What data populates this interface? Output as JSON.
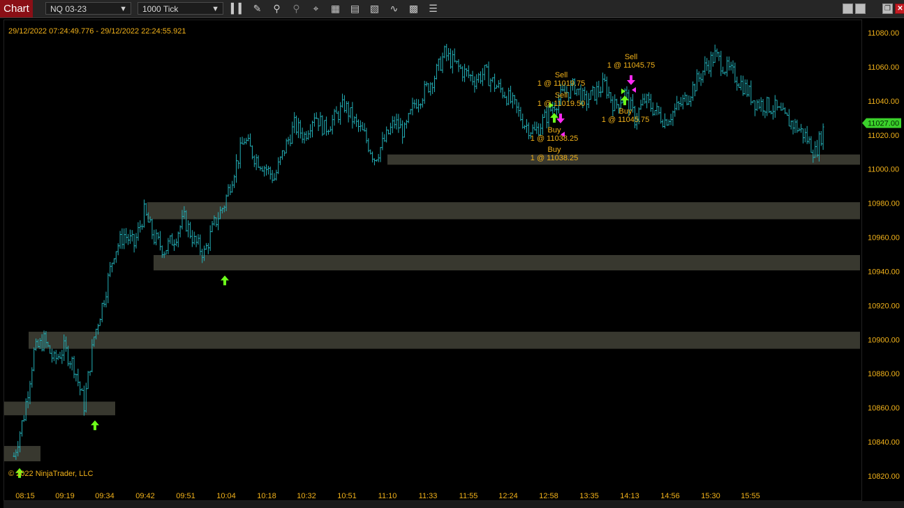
{
  "toolbar": {
    "chart_label": "Chart",
    "instrument": "NQ 03-23",
    "interval": "1000 Tick",
    "icons": [
      "bar-type-icon",
      "drawing-tool-icon",
      "zoom-in-icon",
      "zoom-out-icon",
      "crosshair-icon",
      "data-box-icon",
      "properties-icon",
      "strategies-icon",
      "indicators-icon",
      "templates-icon",
      "list-icon"
    ]
  },
  "chart": {
    "date_range": "29/12/2022 07:24:49.776 - 29/12/2022 22:24:55.921",
    "copyright": "© 2022 NinjaTrader, LLC",
    "current_price_label": "11027.00",
    "colors": {
      "bars": "#23b0b8",
      "zones": "#38382f",
      "buy_arrow": "#6dff1a",
      "sell_arrow": "#ff2af4",
      "text": "#f2b21a",
      "price_tag": "#3bd12b"
    }
  },
  "chart_data": {
    "type": "bar",
    "ylim": [
      10815,
      11088
    ],
    "y_ticks": [
      "10820.00",
      "10840.00",
      "10860.00",
      "10880.00",
      "10900.00",
      "10920.00",
      "10940.00",
      "10960.00",
      "10980.00",
      "11000.00",
      "11020.00",
      "11040.00",
      "11060.00",
      "11080.00"
    ],
    "x_ticks": [
      "08:15",
      "09:19",
      "09:34",
      "09:42",
      "09:51",
      "10:04",
      "10:18",
      "10:32",
      "10:51",
      "11:10",
      "11:33",
      "11:55",
      "12:24",
      "12:58",
      "13:35",
      "14:13",
      "14:56",
      "15:30",
      "15:55"
    ],
    "close_path": [
      10832,
      10856,
      10893,
      10900,
      10888,
      10895,
      10885,
      10862,
      10902,
      10925,
      10952,
      10962,
      10956,
      10975,
      10960,
      10953,
      10960,
      10971,
      10958,
      10951,
      10968,
      10980,
      11000,
      11018,
      11008,
      11002,
      10995,
      11012,
      11026,
      11020,
      11033,
      11024,
      11030,
      11038,
      11028,
      11020,
      11007,
      11017,
      11028,
      11022,
      11039,
      11046,
      11055,
      11068,
      11062,
      11057,
      11053,
      11057,
      11050,
      11045,
      11037,
      11027,
      11022,
      11030,
      11039,
      11045,
      11049,
      11040,
      11045,
      11050,
      11037,
      11045,
      11030,
      11041,
      11035,
      11029,
      11035,
      11041,
      11050,
      11060,
      11067,
      11060,
      11055,
      11048,
      11040,
      11038,
      11036,
      11030,
      11026,
      11020,
      11010,
      11027
    ],
    "zones": [
      {
        "from": "08:15",
        "price_low": 10829,
        "price_high": 10838
      },
      {
        "from": "08:15",
        "price_low": 10856,
        "price_high": 10864
      },
      {
        "from": "09:19",
        "price_low": 10895,
        "price_high": 10905
      },
      {
        "from": "09:51",
        "price_low": 10941,
        "price_high": 10950
      },
      {
        "from": "09:51",
        "price_low": 10971,
        "price_high": 10981
      },
      {
        "from": "11:10",
        "price_low": 11003,
        "price_high": 11009
      }
    ],
    "signals": [
      {
        "type": "buy",
        "time": "08:15",
        "price": 10825
      },
      {
        "type": "buy",
        "time": "09:34",
        "price": 10853
      },
      {
        "type": "buy",
        "time": "10:04",
        "price": 10938
      }
    ],
    "executions": [
      {
        "side": "Sell",
        "text": "1 @ 11019.75",
        "price": 11037
      },
      {
        "side": "Sell",
        "text": "1 @ 11019.50",
        "price": 11032
      },
      {
        "side": "Buy",
        "text": "1 @ 11038.25",
        "price": 11023
      },
      {
        "side": "Buy",
        "text": "1 @ 11038.25",
        "price": 11017
      },
      {
        "side": "Sell",
        "text": "1 @ 11045.75",
        "price": 11056
      },
      {
        "side": "Buy",
        "text": "1 @ 11045.75",
        "price": 11030
      }
    ]
  }
}
